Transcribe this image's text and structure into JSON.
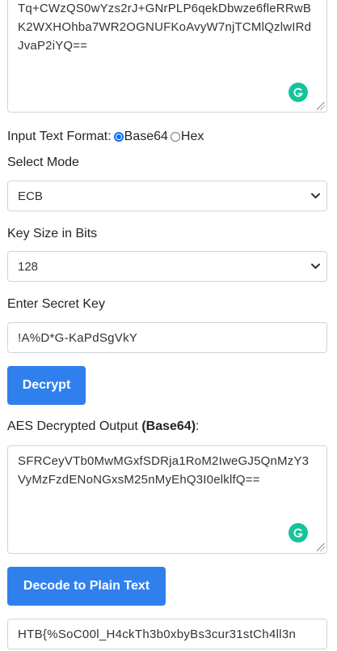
{
  "input_textarea": {
    "value": "Tq+CWzQS0wYzs2rJ+GNrPLP6qekDbwze6fleRRwBK2WXHOhba7WR2OGNUFKoAvyW7njTCMlQzlwIRdJvaP2iYQ=="
  },
  "input_format": {
    "label": "Input Text Format:",
    "options": [
      "Base64",
      "Hex"
    ],
    "selected": "Base64"
  },
  "mode": {
    "label": "Select Mode",
    "selected": "ECB"
  },
  "key_size": {
    "label": "Key Size in Bits",
    "selected": "128"
  },
  "secret_key": {
    "label": "Enter Secret Key",
    "value": "!A%D*G-KaPdSgVkY"
  },
  "decrypt_button": {
    "label": "Decrypt"
  },
  "output": {
    "label_prefix": "AES Decrypted Output",
    "label_format": "(Base64)",
    "label_suffix": ":",
    "value": "SFRCeyVTb0MwMGxfSDRja1RoM2IweGJ5QnMzY3VyMzFzdENoNGxsM25nMyEhQ3I0elklfQ=="
  },
  "decode_button": {
    "label": "Decode to Plain Text"
  },
  "plain_text": {
    "value": "HTB{%SoC00l_H4ckTh3b0xbyBs3cur31stCh4ll3n"
  },
  "colors": {
    "primary": "#2f80ed",
    "grammarly": "#15c39a",
    "border": "#cfd4da"
  },
  "icons": [
    "grammarly-icon",
    "chevron-down-icon",
    "resize-grip-icon"
  ]
}
